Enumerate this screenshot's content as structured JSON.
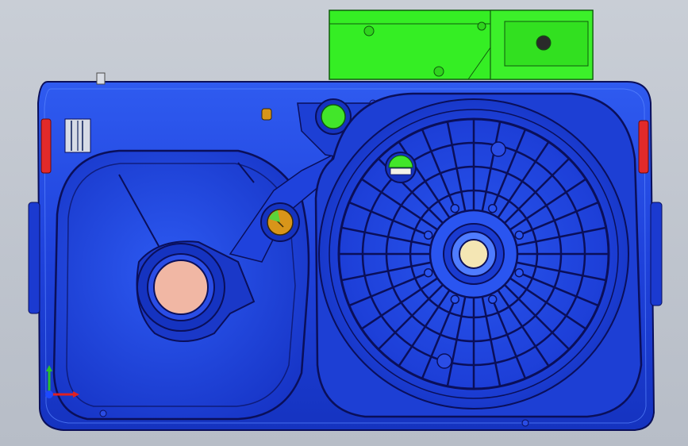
{
  "app": {
    "kind": "3D CAD viewport"
  },
  "model": {
    "body_color": "#1f3bd6",
    "body_dark": "#0b1aa6",
    "body_light": "#3d6cf0",
    "outline": "#0a0f5a",
    "bracket_color": "#33ee22",
    "bracket_dark": "#128a0e",
    "accent_red": "#e22a2a",
    "pink_port": "#f1b7a4",
    "cream_hub": "#f4e6b4",
    "orange_fitting": "#d8951a"
  },
  "triad": {
    "x_color": "#e02020",
    "y_color": "#2bc02b",
    "z_color": "#1d49ff"
  }
}
